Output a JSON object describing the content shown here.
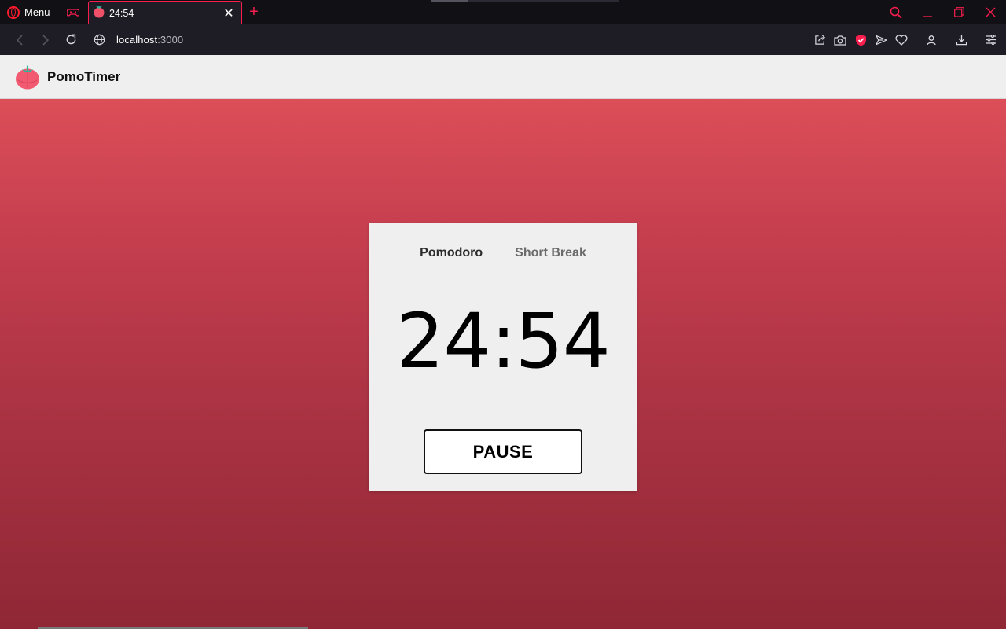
{
  "browser": {
    "menu_label": "Menu",
    "tab": {
      "title": "24:54"
    },
    "new_tab_symbol": "+",
    "url_host": "localhost",
    "url_port": ":3000",
    "accent_color": "#fa1e4e"
  },
  "app": {
    "title": "PomoTimer",
    "logo_icon": "tomato-icon"
  },
  "timer_card": {
    "modes": [
      {
        "label": "Pomodoro",
        "active": true
      },
      {
        "label": "Short Break",
        "active": false
      }
    ],
    "time": "24:54",
    "pause_label": "PAUSE"
  },
  "colors": {
    "gradient_top": "#dc4e58",
    "gradient_bottom": "#8f2735",
    "card_bg": "#efefef"
  }
}
